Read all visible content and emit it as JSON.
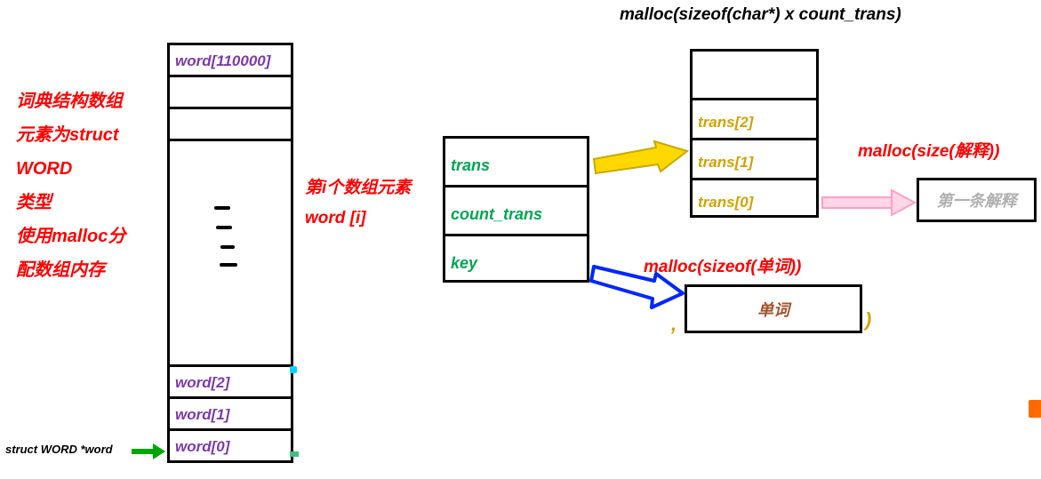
{
  "colors": {
    "red": "#ff0000",
    "purple": "#7c3aad",
    "green": "#00a651",
    "orange": "#d4a000",
    "brown": "#a0522d",
    "gray": "#b0b0b0",
    "yellow_arrow": "#ffd800",
    "pink_arrow": "#ffb0d0",
    "blue_arrow": "#0026ff",
    "green_arrow": "#00a600"
  },
  "description": {
    "line1": "词典结构数组",
    "line2": "元素为struct",
    "line3": "WORD",
    "line4": "类型",
    "line5": "使用malloc分",
    "line6": "配数组内存"
  },
  "pointer_label": "struct WORD *word",
  "word_array": {
    "top": "word[110000]",
    "cell2": "word[2]",
    "cell1": "word[1]",
    "cell0": "word[0]"
  },
  "element_label": {
    "line1": "第i个数组元素",
    "line2": "word [i]"
  },
  "struct_fields": {
    "trans": "trans",
    "count_trans": "count_trans",
    "key": "key"
  },
  "titles": {
    "trans_malloc": "malloc(sizeof(char*) x count_trans)",
    "key_malloc": "malloc(sizeof(单词))",
    "explain_malloc": "malloc(size(解释))"
  },
  "trans_array": {
    "t2": "trans[2]",
    "t1": "trans[1]",
    "t0": "trans[0]"
  },
  "boxes": {
    "word_box": "单词",
    "explain_box": "第一条解释"
  }
}
